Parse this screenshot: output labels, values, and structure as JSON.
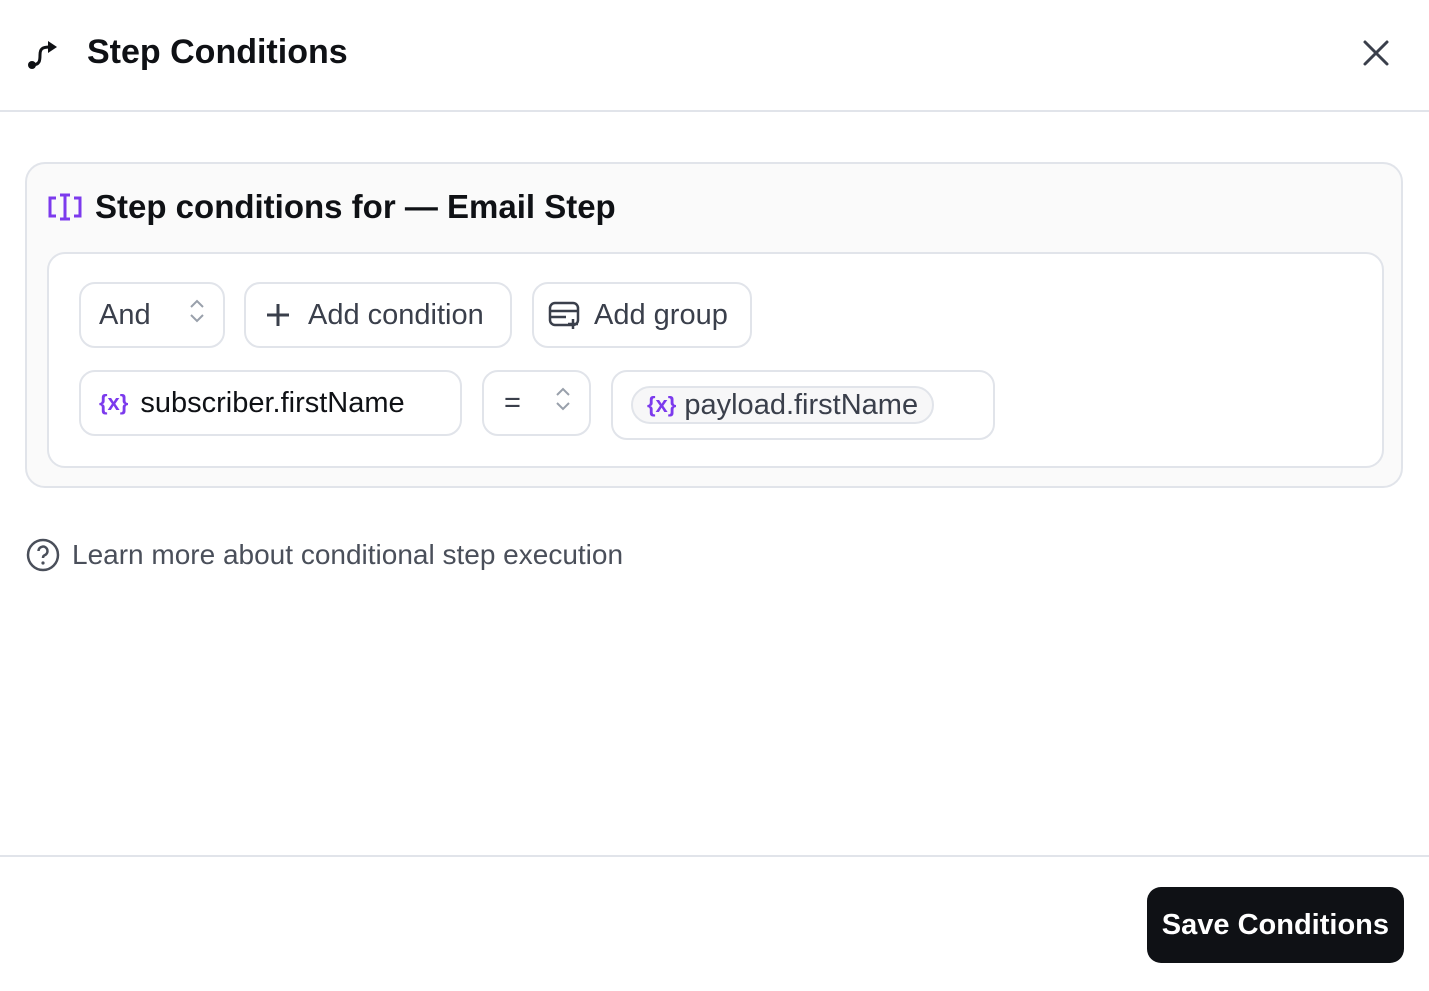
{
  "header": {
    "title": "Step Conditions",
    "icon": "route-icon",
    "close_icon": "close-icon"
  },
  "card": {
    "title": "Step conditions for — Email Step",
    "icon": "text-cursor-bracket-icon",
    "accent": "#7c3aed"
  },
  "toolbar": {
    "combinator": "And",
    "add_condition": "Add condition",
    "add_group": "Add group"
  },
  "condition": {
    "field": "subscriber.firstName",
    "operator": "=",
    "value": "payload.firstName",
    "variable_icon": "{x}"
  },
  "help": {
    "link": "Learn more about conditional step execution"
  },
  "footer": {
    "save": "Save Conditions"
  }
}
